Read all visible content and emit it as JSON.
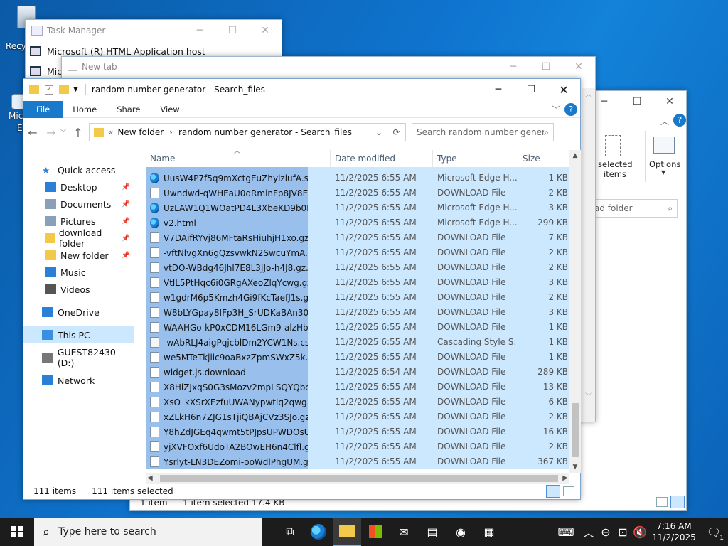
{
  "desktop": {
    "recycle_bin_label": "Recy",
    "edge_label_1": "Micr",
    "edge_label_2": "E"
  },
  "task_manager": {
    "title": "Task Manager",
    "rows": [
      "Microsoft (R) HTML Application host",
      "Micr"
    ]
  },
  "new_tab_window": {
    "title": "New tab"
  },
  "back_window": {
    "ribbon_select_label_1": "de selected",
    "ribbon_select_label_2": "items",
    "options_label": "Options",
    "search_partial": "ad folder",
    "status_count": "1 item",
    "status_selected": "1 item selected  17.4 KB"
  },
  "explorer": {
    "title": "random number generator - Search_files",
    "tabs": [
      "File",
      "Home",
      "Share",
      "View"
    ],
    "path": {
      "prefix": "«",
      "seg1": "New folder",
      "seg2": "random number generator - Search_files"
    },
    "search_placeholder": "Search random number gener...",
    "columns": {
      "name": "Name",
      "date": "Date modified",
      "type": "Type",
      "size": "Size"
    },
    "nav": [
      {
        "label": "Quick access",
        "icon": "star-icon",
        "pin": false
      },
      {
        "label": "Desktop",
        "icon": "desktop-icon",
        "pin": true
      },
      {
        "label": "Documents",
        "icon": "documents-icon",
        "pin": true
      },
      {
        "label": "Pictures",
        "icon": "pictures-icon",
        "pin": true
      },
      {
        "label": "download folder",
        "icon": "folder-icon",
        "pin": true
      },
      {
        "label": "New folder",
        "icon": "folder-icon",
        "pin": true
      },
      {
        "label": "Music",
        "icon": "music-icon",
        "pin": false
      },
      {
        "label": "Videos",
        "icon": "videos-icon",
        "pin": false
      },
      {
        "label": "OneDrive",
        "icon": "cloud-icon",
        "pin": false
      },
      {
        "label": "This PC",
        "icon": "computer-icon",
        "pin": false
      },
      {
        "label": "GUEST82430 (D:)",
        "icon": "drive-icon",
        "pin": false
      },
      {
        "label": "Network",
        "icon": "network-icon",
        "pin": false
      }
    ],
    "files": [
      {
        "name": "UusW4P7f5q9mXctgEuZhylziufA.svg",
        "date": "11/2/2025 6:55 AM",
        "type": "Microsoft Edge H...",
        "size": "1 KB",
        "icon": "edge"
      },
      {
        "name": "Uwndwd-qWHEaU0qRminFp8JV8El.gz.js....",
        "date": "11/2/2025 6:55 AM",
        "type": "DOWNLOAD File",
        "size": "2 KB",
        "icon": "doc"
      },
      {
        "name": "UzLAW1Q1WOatPD4L3XbeKD9b0Lg.svg",
        "date": "11/2/2025 6:55 AM",
        "type": "Microsoft Edge H...",
        "size": "3 KB",
        "icon": "edge"
      },
      {
        "name": "v2.html",
        "date": "11/2/2025 6:55 AM",
        "type": "Microsoft Edge H...",
        "size": "299 KB",
        "icon": "edge"
      },
      {
        "name": "V7DAifRYvj86MFtaRsHiuhjH1xo.gz.js.do...",
        "date": "11/2/2025 6:55 AM",
        "type": "DOWNLOAD File",
        "size": "7 KB",
        "icon": "doc"
      },
      {
        "name": "-vftNlvgXn6gQzsvwkN2SwcuYmA.gz.js.d...",
        "date": "11/2/2025 6:55 AM",
        "type": "DOWNLOAD File",
        "size": "2 KB",
        "icon": "doc"
      },
      {
        "name": "vtDO-WBdg46Jhl7E8L3JJo-h4J8.gz.js.dow...",
        "date": "11/2/2025 6:55 AM",
        "type": "DOWNLOAD File",
        "size": "2 KB",
        "icon": "doc"
      },
      {
        "name": "VtlL5PtHqc6i0GRgAXeoZlqYcwg.gz.js.do...",
        "date": "11/2/2025 6:55 AM",
        "type": "DOWNLOAD File",
        "size": "3 KB",
        "icon": "doc"
      },
      {
        "name": "w1gdrM6p5Kmzh4Gi9fKcTaefJ1s.gz.js.do...",
        "date": "11/2/2025 6:55 AM",
        "type": "DOWNLOAD File",
        "size": "2 KB",
        "icon": "doc"
      },
      {
        "name": "W8bLYGpay8IFp3H_SrUDKaBAn30.gz.js.d...",
        "date": "11/2/2025 6:55 AM",
        "type": "DOWNLOAD File",
        "size": "3 KB",
        "icon": "doc"
      },
      {
        "name": "WAAHGo-kP0xCDM16LGm9-alzHb8.gz.j...",
        "date": "11/2/2025 6:55 AM",
        "type": "DOWNLOAD File",
        "size": "1 KB",
        "icon": "doc"
      },
      {
        "name": "-wAbRLJ4aigPqjcblDm2YCW1Ns.css",
        "date": "11/2/2025 6:55 AM",
        "type": "Cascading Style S...",
        "size": "1 KB",
        "icon": "css"
      },
      {
        "name": "we5MTeTkjiic9oaBxzZpmSWxZ5k.gz.js.do...",
        "date": "11/2/2025 6:55 AM",
        "type": "DOWNLOAD File",
        "size": "1 KB",
        "icon": "doc"
      },
      {
        "name": "widget.js.download",
        "date": "11/2/2025 6:54 AM",
        "type": "DOWNLOAD File",
        "size": "289 KB",
        "icon": "doc"
      },
      {
        "name": "X8HiZJxqS0G3sMozv2mpLSQYQbc.gz.js....",
        "date": "11/2/2025 6:55 AM",
        "type": "DOWNLOAD File",
        "size": "13 KB",
        "icon": "doc"
      },
      {
        "name": "XsO_kXSrXEzfuUWANypwtlq2qwg.gz.js.d...",
        "date": "11/2/2025 6:55 AM",
        "type": "DOWNLOAD File",
        "size": "6 KB",
        "icon": "doc"
      },
      {
        "name": "xZLkH6n7ZJG1sTjiQBAjCVz3SJo.gz.js.dow...",
        "date": "11/2/2025 6:55 AM",
        "type": "DOWNLOAD File",
        "size": "2 KB",
        "icon": "doc"
      },
      {
        "name": "Y8hZdJGEq4qwmt5tPJpsUPWDOsU.gz.js....",
        "date": "11/2/2025 6:55 AM",
        "type": "DOWNLOAD File",
        "size": "16 KB",
        "icon": "doc"
      },
      {
        "name": "yjXVFOxf6UdoTA2BOwEH6n4Clfl.gz.js.do...",
        "date": "11/2/2025 6:55 AM",
        "type": "DOWNLOAD File",
        "size": "2 KB",
        "icon": "doc"
      },
      {
        "name": "Ysrlyt-LN3DEZomi-ooWdlPhgUM.gz.js.d...",
        "date": "11/2/2025 6:55 AM",
        "type": "DOWNLOAD File",
        "size": "367 KB",
        "icon": "doc"
      }
    ],
    "status": {
      "count": "111 items",
      "selected": "111 items selected"
    }
  },
  "taskbar": {
    "search_placeholder": "Type here to search",
    "time": "7:16 AM",
    "date": "11/2/2025",
    "notification_count": "1"
  },
  "colors": {
    "accent": "#1979ca",
    "selection_name": "#99c0ec",
    "selection_row": "#cce8ff",
    "taskbar": "#1c1c1c"
  }
}
